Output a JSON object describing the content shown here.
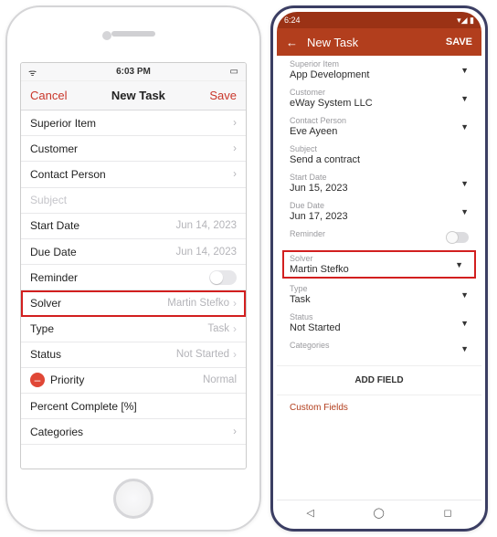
{
  "ios": {
    "status": {
      "time": "6:03 PM"
    },
    "header": {
      "cancel": "Cancel",
      "title": "New Task",
      "save": "Save"
    },
    "rows": {
      "superior": "Superior Item",
      "customer": "Customer",
      "contact": "Contact Person",
      "subject_placeholder": "Subject",
      "start_label": "Start Date",
      "start_val": "Jun 14, 2023",
      "due_label": "Due Date",
      "due_val": "Jun 14, 2023",
      "reminder": "Reminder",
      "solver_label": "Solver",
      "solver_val": "Martin Stefko",
      "type_label": "Type",
      "type_val": "Task",
      "status_label": "Status",
      "status_val": "Not Started",
      "priority_label": "Priority",
      "priority_val": "Normal",
      "percent": "Percent Complete [%]",
      "categories": "Categories"
    }
  },
  "android": {
    "status": {
      "time": "6:24"
    },
    "header": {
      "title": "New Task",
      "save": "SAVE"
    },
    "fields": {
      "superior_l": "Superior Item",
      "superior_v": "App Development",
      "customer_l": "Customer",
      "customer_v": "eWay System LLC",
      "contact_l": "Contact Person",
      "contact_v": "Eve Ayeen",
      "subject_l": "Subject",
      "subject_v": "Send a contract",
      "start_l": "Start Date",
      "start_v": "Jun 15, 2023",
      "due_l": "Due Date",
      "due_v": "Jun 17, 2023",
      "reminder_l": "Reminder",
      "solver_l": "Solver",
      "solver_v": "Martin Stefko",
      "type_l": "Type",
      "type_v": "Task",
      "status_l": "Status",
      "status_v": "Not Started",
      "categories_l": "Categories"
    },
    "addfield": "ADD FIELD",
    "custom": "Custom Fields"
  }
}
